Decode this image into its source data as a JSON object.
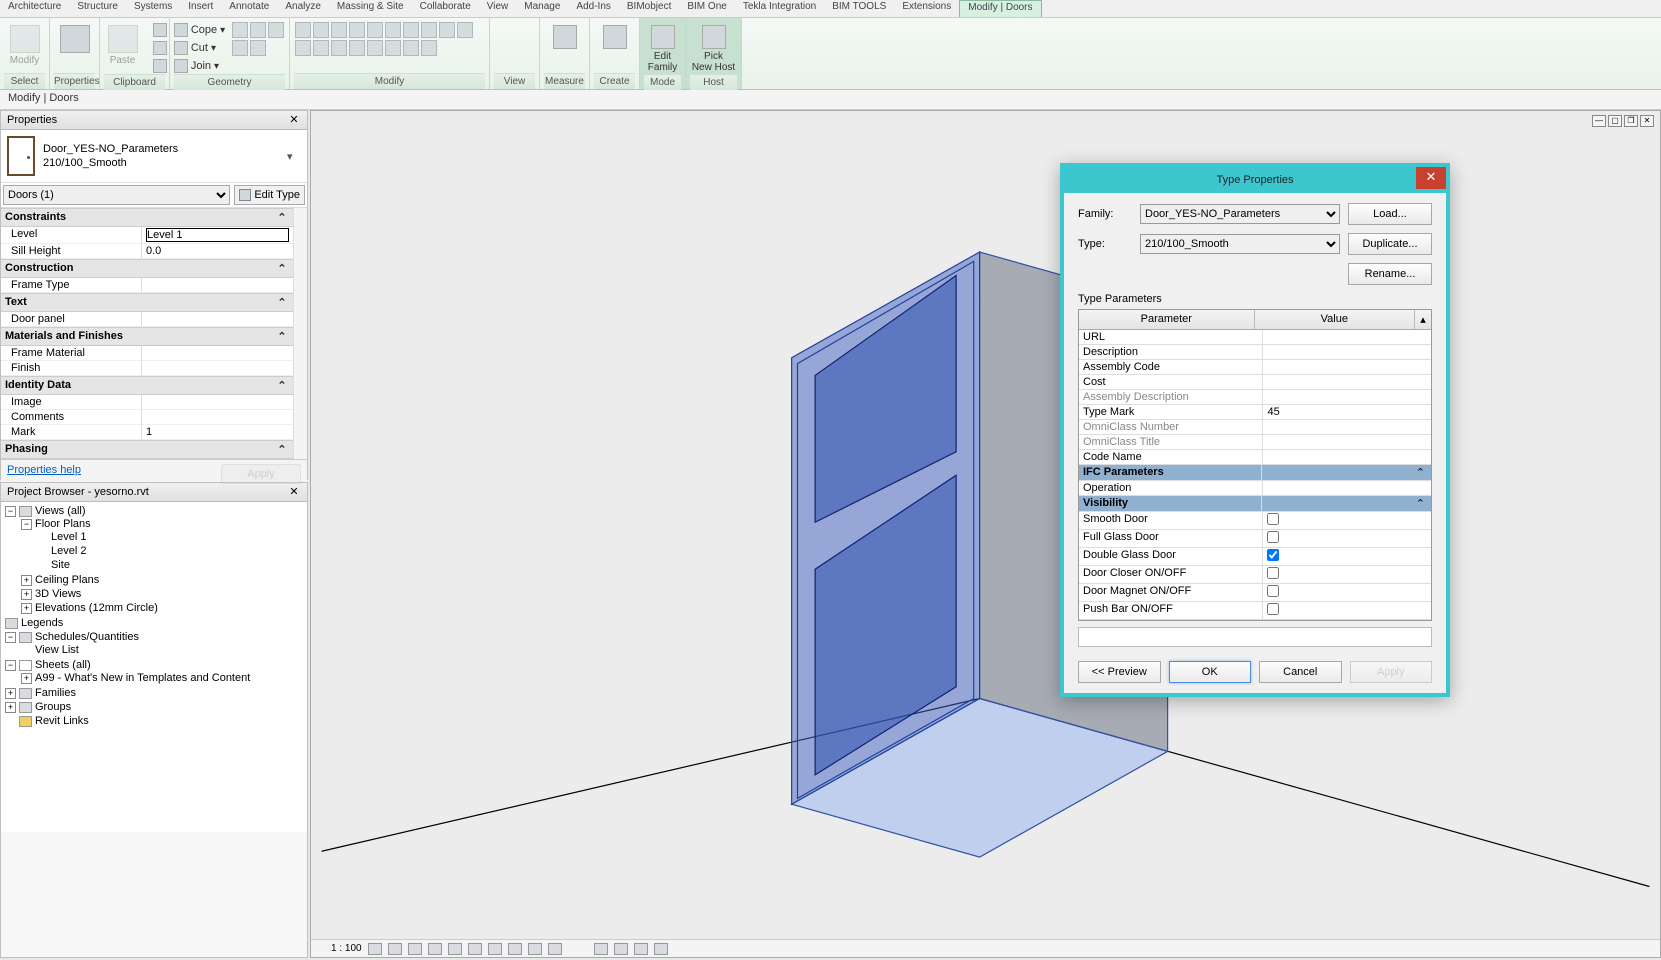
{
  "menu_tabs": [
    "Architecture",
    "Structure",
    "Systems",
    "Insert",
    "Annotate",
    "Analyze",
    "Massing & Site",
    "Collaborate",
    "View",
    "Manage",
    "Add-Ins",
    "BIMobject",
    "BIM One",
    "Tekla Integration",
    "BIM TOOLS",
    "Extensions",
    "Modify | Doors"
  ],
  "active_tab": "Modify | Doors",
  "ribbon": {
    "select": "Select",
    "select_btn": "Modify",
    "properties": "Properties",
    "clipboard": "Clipboard",
    "paste": "Paste",
    "cope": "Cope",
    "cut": "Cut",
    "join": "Join",
    "geometry": "Geometry",
    "modify": "Modify",
    "view": "View",
    "measure": "Measure",
    "create": "Create",
    "edit_family": "Edit\nFamily",
    "pick_host": "Pick\nNew Host",
    "mode": "Mode",
    "host": "Host"
  },
  "modify_bar": "Modify | Doors",
  "props": {
    "title": "Properties",
    "family": "Door_YES-NO_Parameters",
    "type": "210/100_Smooth",
    "filter": "Doors (1)",
    "edit_type": "Edit Type",
    "groups": {
      "constraints": "Constraints",
      "construction": "Construction",
      "text": "Text",
      "materials": "Materials and Finishes",
      "identity": "Identity Data",
      "phasing": "Phasing"
    },
    "params": {
      "level_l": "Level",
      "level_v": "Level 1",
      "sill_l": "Sill Height",
      "sill_v": "0.0",
      "frametype_l": "Frame Type",
      "frametype_v": "",
      "doorpanel_l": "Door panel",
      "doorpanel_v": "",
      "framemat_l": "Frame Material",
      "framemat_v": "",
      "finish_l": "Finish",
      "finish_v": "",
      "image_l": "Image",
      "image_v": "",
      "comments_l": "Comments",
      "comments_v": "",
      "mark_l": "Mark",
      "mark_v": "1"
    },
    "help": "Properties help",
    "apply": "Apply"
  },
  "browser": {
    "title": "Project Browser - yesorno.rvt",
    "views": "Views (all)",
    "floorplans": "Floor Plans",
    "l1": "Level 1",
    "l2": "Level 2",
    "site": "Site",
    "ceiling": "Ceiling Plans",
    "v3d": "3D Views",
    "elev": "Elevations (12mm Circle)",
    "legends": "Legends",
    "sched": "Schedules/Quantities",
    "viewlist": "View List",
    "sheets": "Sheets (all)",
    "a99": "A99 - What's New in Templates and Content",
    "families": "Families",
    "groups": "Groups",
    "revitlinks": "Revit Links"
  },
  "viewbar": {
    "scale": "1 : 100"
  },
  "dialog": {
    "title": "Type Properties",
    "family_l": "Family:",
    "family_v": "Door_YES-NO_Parameters",
    "type_l": "Type:",
    "type_v": "210/100_Smooth",
    "load": "Load...",
    "duplicate": "Duplicate...",
    "rename": "Rename...",
    "tp": "Type Parameters",
    "h_param": "Parameter",
    "h_value": "Value",
    "rows": {
      "url": "URL",
      "desc": "Description",
      "asm": "Assembly Code",
      "cost": "Cost",
      "asmd": "Assembly Description",
      "tmark_l": "Type Mark",
      "tmark_v": "45",
      "omnin": "OmniClass Number",
      "omnit": "OmniClass Title",
      "code": "Code Name",
      "ifc": "IFC Parameters",
      "oper": "Operation",
      "vis": "Visibility",
      "smooth": "Smooth Door",
      "full": "Full Glass Door",
      "double": "Double Glass Door",
      "closer": "Door Closer ON/OFF",
      "magnet": "Door Magnet ON/OFF",
      "push": "Push Bar ON/OFF"
    },
    "checks": {
      "smooth": false,
      "full": false,
      "double": true,
      "closer": false,
      "magnet": false,
      "push": false
    },
    "preview": "<< Preview",
    "ok": "OK",
    "cancel": "Cancel",
    "apply": "Apply"
  }
}
